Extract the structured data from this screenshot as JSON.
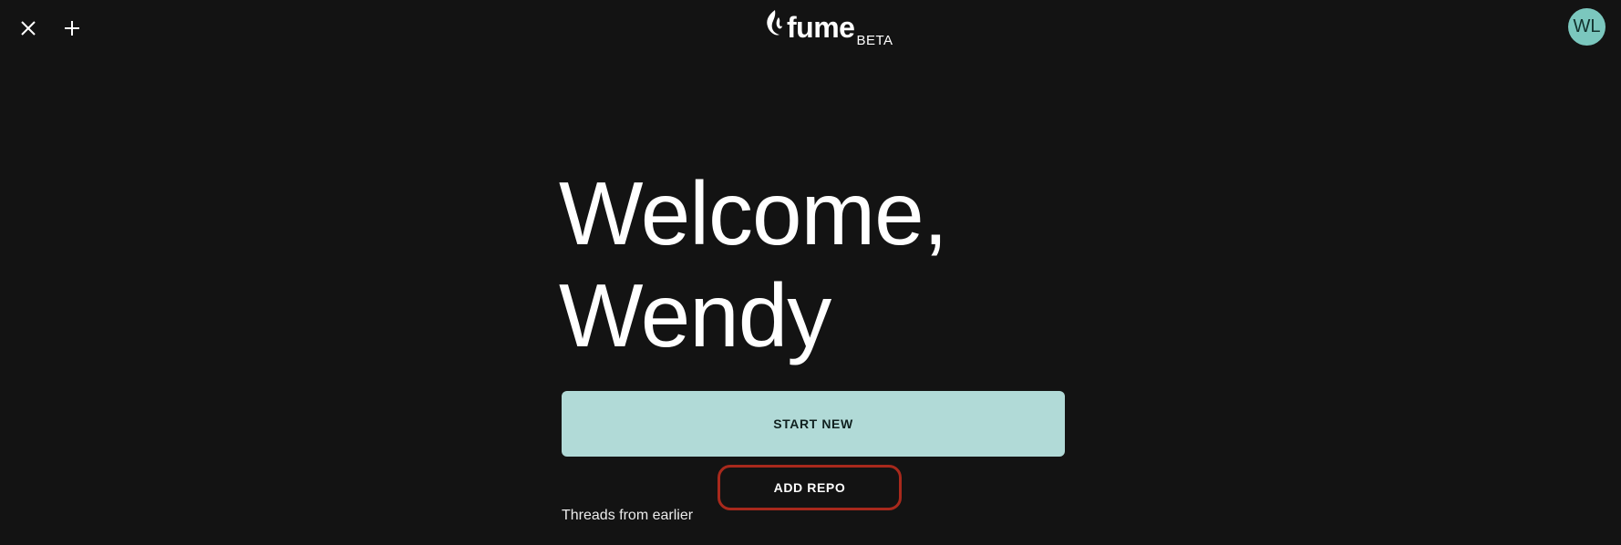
{
  "header": {
    "close_icon": "close-icon",
    "add_icon": "plus-icon",
    "logo": {
      "wordmark": "fume",
      "badge": "BETA"
    },
    "avatar_initials": "WL"
  },
  "main": {
    "welcome_line1": "Welcome,",
    "welcome_line2": "Wendy",
    "start_button_label": "START NEW",
    "add_repo_button_label": "ADD REPO",
    "threads_heading": "Threads from earlier"
  },
  "colors": {
    "background": "#131313",
    "accent": "#b1dad7",
    "avatar": "#7bc7be",
    "highlight_outline": "#a8291c"
  }
}
